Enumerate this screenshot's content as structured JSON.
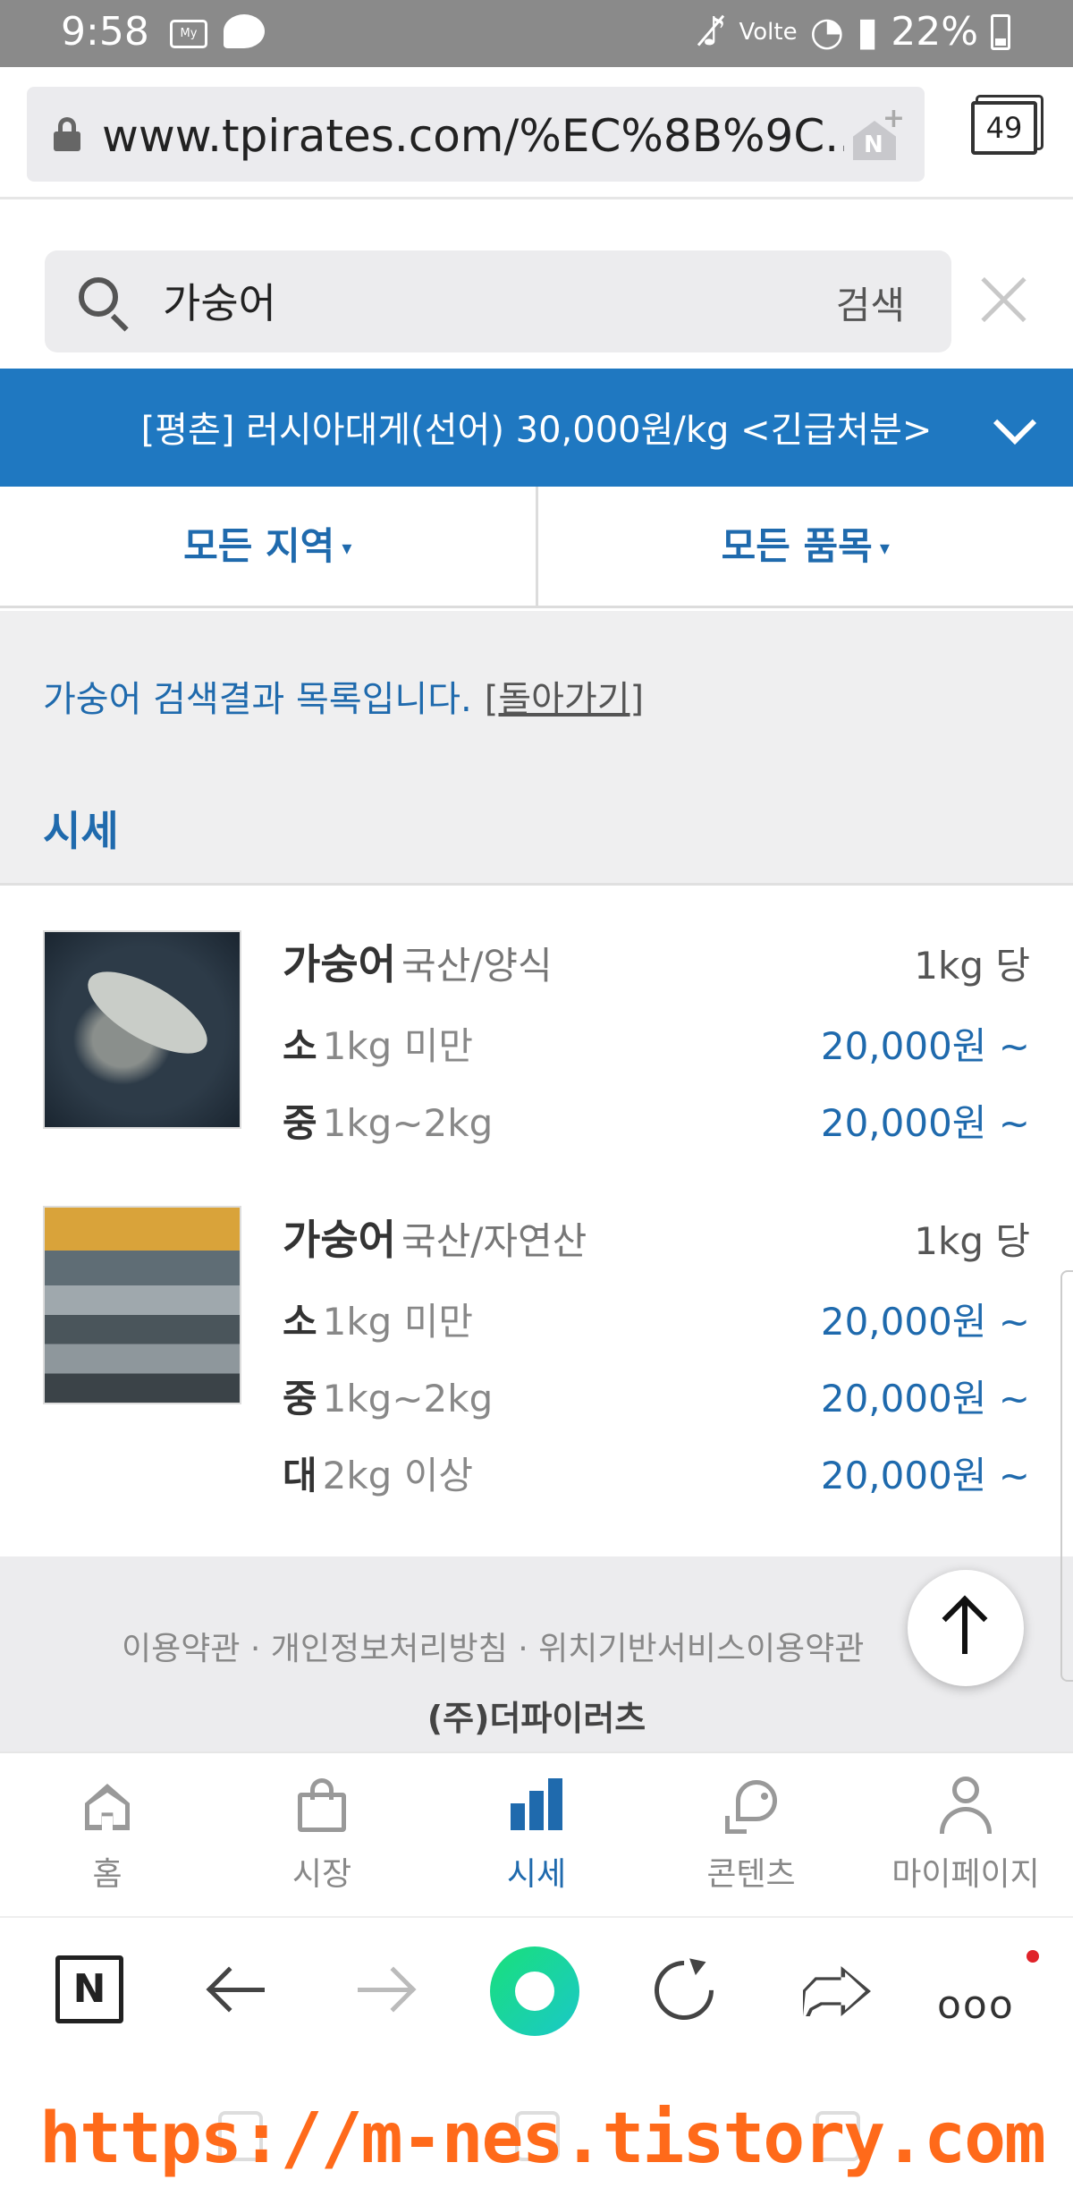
{
  "status_bar": {
    "time": "9:58",
    "app_icon_text": "My",
    "network": "Volte",
    "battery": "22%"
  },
  "browser": {
    "url": "www.tpirates.com/%EC%8B%9C...",
    "tab_count": "49"
  },
  "search": {
    "value": "가숭어",
    "button_label": "검색"
  },
  "notice": {
    "text": "[평촌] 러시아대게(선어) 30,000원/kg <긴급처분>"
  },
  "filters": {
    "region": "모든 지역",
    "item": "모든 품목"
  },
  "result": {
    "message": "가숭어 검색결과 목록입니다.",
    "back_link": "[돌아가기]",
    "section_title": "시세"
  },
  "items": [
    {
      "name": "가숭어",
      "origin": "국산/양식",
      "unit": "1kg 당",
      "sizes": [
        {
          "label": "소",
          "range": "1kg 미만",
          "price": "20,000원 ~"
        },
        {
          "label": "중",
          "range": "1kg~2kg",
          "price": "20,000원 ~"
        }
      ]
    },
    {
      "name": "가숭어",
      "origin": "국산/자연산",
      "unit": "1kg 당",
      "sizes": [
        {
          "label": "소",
          "range": "1kg 미만",
          "price": "20,000원 ~"
        },
        {
          "label": "중",
          "range": "1kg~2kg",
          "price": "20,000원 ~"
        },
        {
          "label": "대",
          "range": "2kg 이상",
          "price": "20,000원 ~"
        }
      ]
    }
  ],
  "footer": {
    "links": "이용약관 · 개인정보처리방침 · 위치기반서비스이용약관",
    "company": "(주)더파이러츠"
  },
  "bottom_nav": [
    {
      "label": "홈",
      "icon": "home-icon"
    },
    {
      "label": "시장",
      "icon": "shopping-bag-icon"
    },
    {
      "label": "시세",
      "icon": "bar-chart-icon",
      "active": true
    },
    {
      "label": "콘텐츠",
      "icon": "fish-icon"
    },
    {
      "label": "마이페이지",
      "icon": "person-icon"
    }
  ],
  "browser_toolbar": {
    "naver_label": "N",
    "more_label": "ooo"
  },
  "watermark": "https://m-nes.tistory.com",
  "colors": {
    "accent": "#1f78c1",
    "link_blue": "#1f6aad",
    "watermark": "#ff6a1a"
  }
}
